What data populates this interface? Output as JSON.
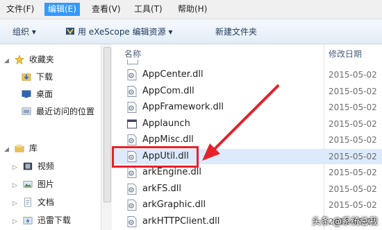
{
  "menubar": {
    "items": [
      {
        "label": "文件(F)"
      },
      {
        "label": "编辑(E)"
      },
      {
        "label": "查看(V)"
      },
      {
        "label": "工具(T)"
      },
      {
        "label": "帮助(H)"
      }
    ]
  },
  "toolbar": {
    "organize_label": "组织 ▾",
    "open_with_label": "用 eXeScope 编辑资源 ▾",
    "new_folder_label": "新建文件夹"
  },
  "nav": {
    "favorites_label": "收藏夹",
    "downloads_label": "下载",
    "desktop_label": "桌面",
    "recent_label": "最近访问的位置",
    "library_label": "库",
    "videos_label": "视频",
    "pictures_label": "图片",
    "documents_label": "文档",
    "thunder_label": "迅雷下载"
  },
  "file_list": {
    "col_name": "名称",
    "col_date": "修改日期",
    "rows": [
      {
        "name": "AppCenter.dll",
        "date": "2015-05-02",
        "icon": "dll-file-icon"
      },
      {
        "name": "AppCom.dll",
        "date": "2015-05-02",
        "icon": "dll-file-icon"
      },
      {
        "name": "AppFramework.dll",
        "date": "2015-05-02",
        "icon": "dll-file-icon"
      },
      {
        "name": "Applaunch",
        "date": "2015-05-02",
        "icon": "app-window-icon"
      },
      {
        "name": "AppMisc.dll",
        "date": "2015-05-02",
        "icon": "dll-file-icon"
      },
      {
        "name": "AppUtil.dll",
        "date": "2015-05-02",
        "icon": "dll-file-icon"
      },
      {
        "name": "arkEngine.dll",
        "date": "2015-05-02",
        "icon": "dll-file-icon"
      },
      {
        "name": "arkFS.dll",
        "date": "2015-05-02",
        "icon": "dll-file-icon"
      },
      {
        "name": "arkGraphic.dll",
        "date": "2015-05-02",
        "icon": "dll-file-icon"
      },
      {
        "name": "arkHTTPClient.dll",
        "date": "2015-05-02",
        "icon": "dll-file-icon"
      }
    ]
  },
  "watermark": "头条 @系统总裁",
  "colors": {
    "accent": "#3399ff",
    "annotation": "#e8202a"
  }
}
